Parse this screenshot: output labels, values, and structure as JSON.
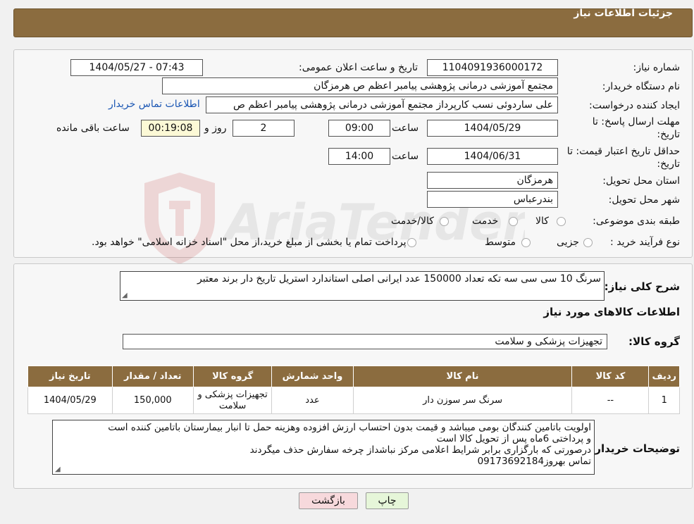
{
  "header": {
    "title": "جزئیات اطلاعات نیاز"
  },
  "form": {
    "need_number_label": "شماره نیاز:",
    "need_number": "1104091936000172",
    "announce_label": "تاریخ و ساعت اعلان عمومی:",
    "announce_value": "1404/05/27 - 07:43",
    "buyer_org_label": "نام دستگاه خریدار:",
    "buyer_org": "مجتمع آموزشی درمانی پژوهشی پیامبر اعظم ص  هرمزگان",
    "creator_label": "ایجاد کننده درخواست:",
    "creator": "علی ساردوئی نسب کارپرداز مجتمع آموزشی درمانی پژوهشی پیامبر اعظم ص",
    "contact_link": "اطلاعات تماس خریدار",
    "deadline_label": "مهلت ارسال پاسخ: تا تاریخ:",
    "deadline_date": "1404/05/29",
    "time_label": "ساعت",
    "deadline_time": "09:00",
    "days_value": "2",
    "days_label": "روز و",
    "remaining_time": "00:19:08",
    "remaining_label": "ساعت باقی مانده",
    "validity_label": "حداقل تاریخ اعتبار قیمت: تا تاریخ:",
    "validity_date": "1404/06/31",
    "validity_time": "14:00",
    "province_label": "استان محل تحویل:",
    "province": "هرمزگان",
    "city_label": "شهر محل تحویل:",
    "city": "بندرعباس",
    "category_label": "طبقه بندی موضوعی:",
    "category_options": [
      "کالا",
      "خدمت",
      "کالا/خدمت"
    ],
    "process_label": "نوع فرآیند خرید :",
    "process_options": [
      "جزیی",
      "متوسط"
    ],
    "process_note": "پرداخت تمام یا بخشی از مبلغ خرید،از محل \"اسناد خزانه اسلامی\" خواهد بود."
  },
  "summary": {
    "label": "شرح کلی نیاز:",
    "text": "سرنگ 10 سی سی سه تکه تعداد 150000 عدد ایرانی اصلی استاندارد استریل تاریخ دار برند معتبر"
  },
  "goods": {
    "section_title": "اطلاعات کالاهای مورد نیاز",
    "group_label": "گروه کالا:",
    "group_value": "تجهیزات پزشکی و سلامت",
    "columns": [
      "ردیف",
      "کد کالا",
      "نام کالا",
      "واحد شمارش",
      "گروه کالا",
      "تعداد / مقدار",
      "تاریخ نیاز"
    ],
    "rows": [
      [
        "1",
        "--",
        "سرنگ سر سوزن دار",
        "عدد",
        "تجهیزات پزشکی و سلامت",
        "150,000",
        "1404/05/29"
      ]
    ]
  },
  "buyer_notes": {
    "label": "توضیحات خریدار:",
    "lines": [
      "اولویت باتامین کنندگان بومی میباشد و قیمت بدون احتساب ارزش افزوده وهزینه حمل تا انبار بیمارستان باتامین کننده است",
      "و پرداختی 6ماه پس از تحویل کالا است",
      "درصورتی که بارگزاری برابر شرایط اعلامی مرکز نباشداز چرخه سفارش حذف میگردند",
      "تماس بهروز09173692184"
    ]
  },
  "buttons": {
    "print": "چاپ",
    "back": "بازگشت"
  },
  "watermark": {
    "text": "AriaTender.neT"
  },
  "colors": {
    "header": "#8b6c3f",
    "link": "#1a56b3",
    "timer_bg": "#fcf9d6",
    "back_btn": "#f7d9dc",
    "print_btn": "#e6f6d9"
  }
}
